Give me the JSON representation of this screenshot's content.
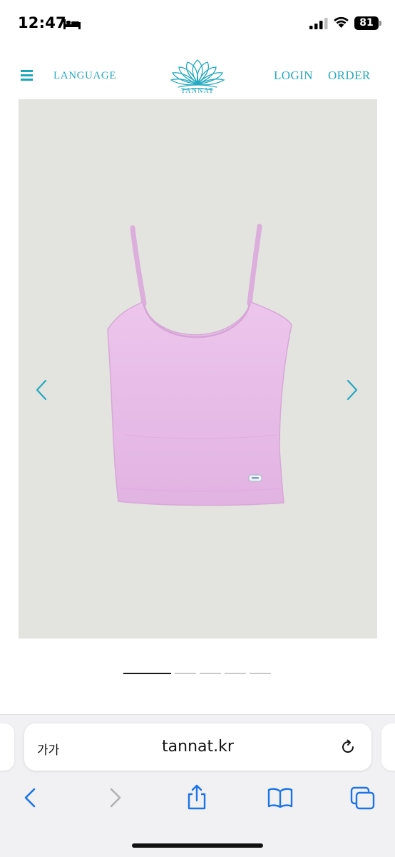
{
  "status_bar": {
    "time": "12:47",
    "battery": "81",
    "icons": [
      "bed-icon",
      "cellular-signal-icon",
      "wifi-icon",
      "battery-icon"
    ]
  },
  "header": {
    "menu_icon": "hamburger-menu-icon",
    "language": "LANGUAGE",
    "logo_text": "TANNAT",
    "login": "LOGIN",
    "order": "ORDER",
    "accent_color": "#25a9c0"
  },
  "gallery": {
    "product_color": "#e6bde6",
    "background_color": "#e3e3df",
    "prev_icon": "chevron-left-icon",
    "next_icon": "chevron-right-icon",
    "slide_count": 5,
    "active_slide": 1
  },
  "browser": {
    "text_size_label": "가가",
    "url": "tannat.kr",
    "icons": [
      "reload-icon",
      "back-icon",
      "forward-icon",
      "share-icon",
      "bookmarks-icon",
      "tabs-icon"
    ]
  }
}
